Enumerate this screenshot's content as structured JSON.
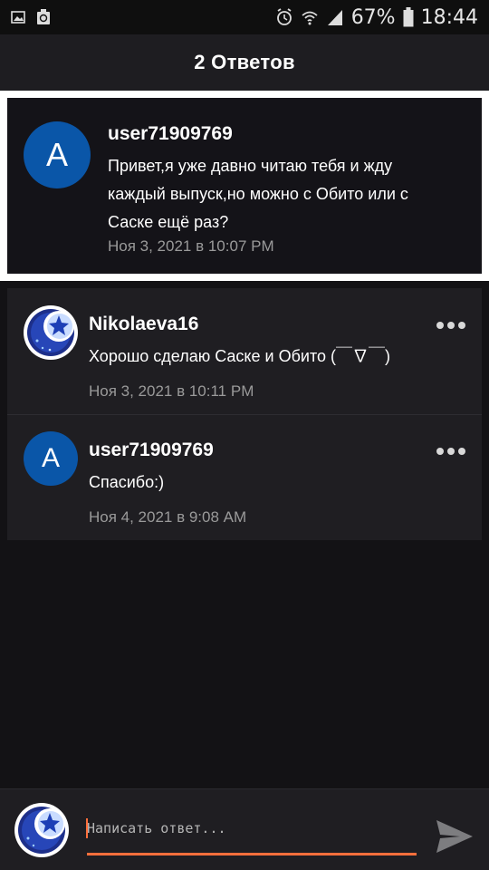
{
  "status_bar": {
    "battery": "67%",
    "time": "18:44",
    "icons": [
      "image-icon",
      "recycle-icon",
      "alarm-icon",
      "wifi-icon",
      "signal-icon",
      "battery-icon"
    ]
  },
  "header": {
    "title": "2 Ответов"
  },
  "original_comment": {
    "avatar_letter": "A",
    "username": "user71909769",
    "text_lines": [
      "Привет,я уже давно читаю тебя и жду",
      "каждый выпуск,но можно с Обито или с",
      "Саске ещё раз?"
    ],
    "timestamp": "Ноя 3, 2021 в 10:07 PM"
  },
  "replies": [
    {
      "username": "Nikolaeva16",
      "text": "Хорошо сделаю Саске и Обито (￣∇￣)",
      "timestamp": "Ноя 3, 2021 в 10:11 PM",
      "avatar": "crescent-star-avatar"
    },
    {
      "username": "user71909769",
      "avatar_letter": "A",
      "text": "Спасибо:)",
      "timestamp": "Ноя 4, 2021 в 9:08 AM"
    }
  ],
  "reply_box": {
    "placeholder": "Написать ответ..."
  },
  "colors": {
    "accent": "#ff6f3c",
    "avatar_blue": "#0a56a8",
    "background": "#131215",
    "panel": "#1f1e22"
  }
}
